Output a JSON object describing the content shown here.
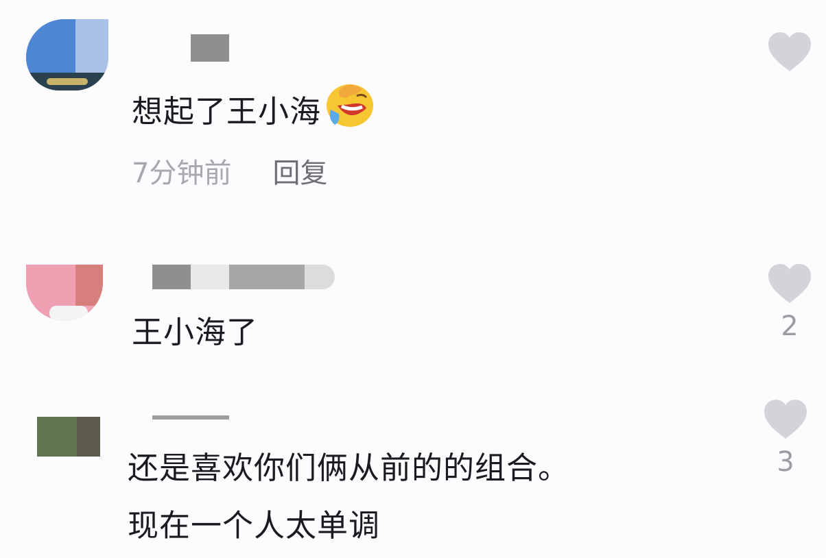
{
  "comments": [
    {
      "text": "想起了王小海",
      "emoji": "rolling-on-floor-laughing-emoji",
      "time": "7分钟前",
      "reply_label": "回复",
      "likes": ""
    },
    {
      "text": "王小海了",
      "likes": "2"
    },
    {
      "text_line1": "还是喜欢你们俩从前的的组合。",
      "text_line2": "现在一个人太单调",
      "likes": "3"
    }
  ],
  "colors": {
    "background": "#fcfbfe",
    "like_icon": "#d4d3d7",
    "text": "#1b1b1f",
    "meta_text": "#a7a7ae"
  },
  "icons": {
    "like": "heart-icon"
  }
}
